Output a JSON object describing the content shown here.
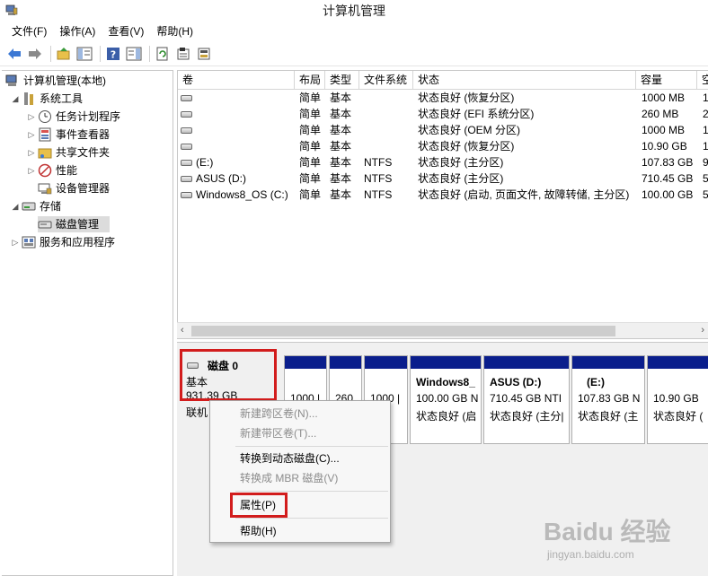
{
  "window": {
    "title": "计算机管理"
  },
  "menu": [
    "文件(F)",
    "操作(A)",
    "查看(V)",
    "帮助(H)"
  ],
  "toolbar_icons": [
    "back-arrow-icon",
    "forward-arrow-icon",
    "up-folder-icon",
    "show-hide-tree-icon",
    "help-icon",
    "show-hide-action-pane-icon",
    "refresh-icon",
    "properties-icon",
    "disk-wizard-icon"
  ],
  "tree": {
    "root": "计算机管理(本地)",
    "system_tools": "系统工具",
    "task_scheduler": "任务计划程序",
    "event_viewer": "事件查看器",
    "shared_folders": "共享文件夹",
    "performance": "性能",
    "device_manager": "设备管理器",
    "storage": "存储",
    "disk_management": "磁盘管理",
    "services_apps": "服务和应用程序"
  },
  "volumes": {
    "columns": [
      "卷",
      "布局",
      "类型",
      "文件系统",
      "状态",
      "容量",
      "空"
    ],
    "rows": [
      {
        "name": "",
        "layout": "简单",
        "type": "基本",
        "fs": "",
        "status": "状态良好 (恢复分区)",
        "capacity": "1000 MB",
        "free": "1"
      },
      {
        "name": "",
        "layout": "简单",
        "type": "基本",
        "fs": "",
        "status": "状态良好 (EFI 系统分区)",
        "capacity": "260 MB",
        "free": "2"
      },
      {
        "name": "",
        "layout": "简单",
        "type": "基本",
        "fs": "",
        "status": "状态良好 (OEM 分区)",
        "capacity": "1000 MB",
        "free": "1"
      },
      {
        "name": "",
        "layout": "简单",
        "type": "基本",
        "fs": "",
        "status": "状态良好 (恢复分区)",
        "capacity": "10.90 GB",
        "free": "1"
      },
      {
        "name": "(E:)",
        "layout": "简单",
        "type": "基本",
        "fs": "NTFS",
        "status": "状态良好 (主分区)",
        "capacity": "107.83 GB",
        "free": "9"
      },
      {
        "name": "ASUS (D:)",
        "layout": "简单",
        "type": "基本",
        "fs": "NTFS",
        "status": "状态良好 (主分区)",
        "capacity": "710.45 GB",
        "free": "5"
      },
      {
        "name": "Windows8_OS (C:)",
        "layout": "简单",
        "type": "基本",
        "fs": "NTFS",
        "status": "状态良好 (启动, 页面文件, 故障转储, 主分区)",
        "capacity": "100.00 GB",
        "free": "5"
      }
    ]
  },
  "disk0": {
    "name": "磁盘 0",
    "type": "基本",
    "size": "931.39 GB",
    "status": "联机"
  },
  "partitions": [
    {
      "title": "",
      "line1": "1000 |",
      "line2": ""
    },
    {
      "title": "",
      "line1": "260",
      "line2": ""
    },
    {
      "title": "",
      "line1": "1000 |",
      "line2": ""
    },
    {
      "title": "Windows8_",
      "line1": "100.00 GB N",
      "line2": "状态良好 (启"
    },
    {
      "title": "ASUS  (D:)",
      "line1": "710.45 GB NTI",
      "line2": "状态良好 (主分|"
    },
    {
      "title": "(E:)",
      "line1": "107.83 GB N",
      "line2": "状态良好 (主"
    },
    {
      "title": "",
      "line1": "10.90 GB",
      "line2": "状态良好 ("
    }
  ],
  "context_menu": {
    "new_spanned": "新建跨区卷(N)...",
    "new_striped": "新建带区卷(T)...",
    "convert_dynamic": "转换到动态磁盘(C)...",
    "convert_mbr": "转换成 MBR 磁盘(V)",
    "properties": "属性(P)",
    "help": "帮助(H)"
  },
  "watermark": {
    "brand": "Baidu 经验",
    "url": "jingyan.baidu.com"
  },
  "colors": {
    "partition_bar": "#0a1e8c",
    "highlight_box": "#d21c1c"
  }
}
